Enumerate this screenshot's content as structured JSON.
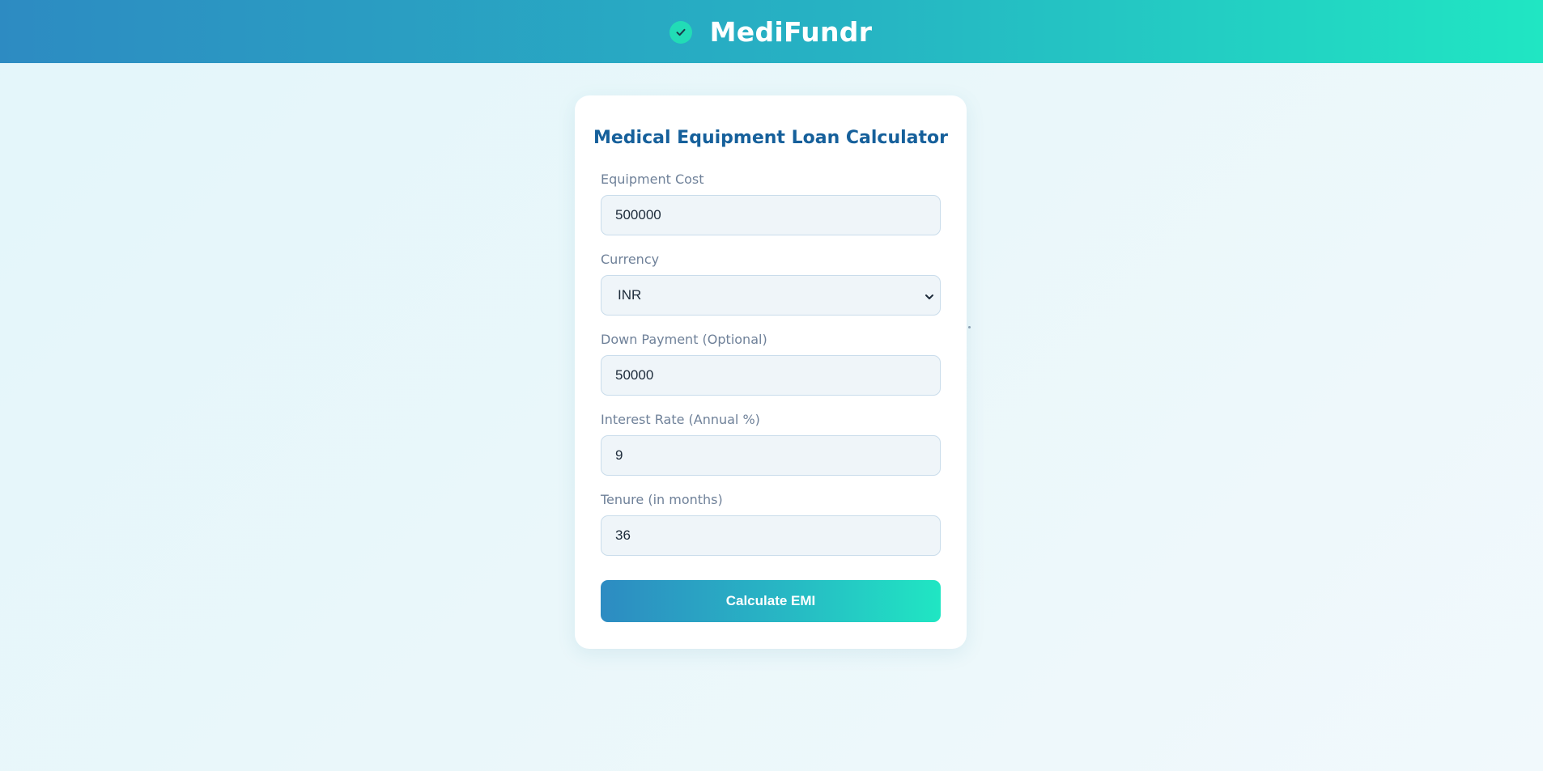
{
  "header": {
    "brand_name": "MediFundr",
    "brand_icon": "check-circle-icon",
    "colors": {
      "gradient_start": "#2d8bc2",
      "gradient_end": "#20e6c3"
    }
  },
  "calculator": {
    "title": "Medical Equipment Loan Calculator",
    "fields": {
      "equipment_cost": {
        "label": "Equipment Cost",
        "value": "500000"
      },
      "currency": {
        "label": "Currency",
        "value": "INR",
        "icon": "chevron-down-icon"
      },
      "down_payment": {
        "label": "Down Payment  (Optional)",
        "value": "50000"
      },
      "interest_rate": {
        "label": "Interest Rate  (Annual %)",
        "value": "9"
      },
      "tenure": {
        "label": "Tenure  (in months)",
        "value": "36"
      }
    },
    "submit_label": "Calculate EMI",
    "colors": {
      "title": "#16609b",
      "label": "#6f8199",
      "input_bg": "#eff5f9"
    }
  }
}
